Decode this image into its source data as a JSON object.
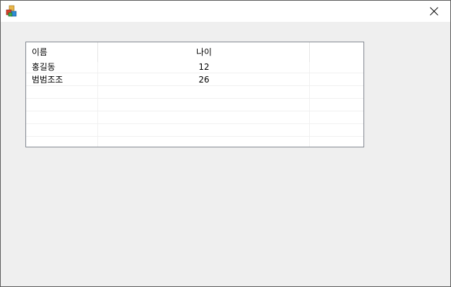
{
  "window": {
    "close_label": "✕"
  },
  "list": {
    "columns": [
      "이름",
      "나이"
    ],
    "rows": [
      {
        "name": "홍길동",
        "age": "12"
      },
      {
        "name": "범범조조",
        "age": "26"
      }
    ]
  }
}
